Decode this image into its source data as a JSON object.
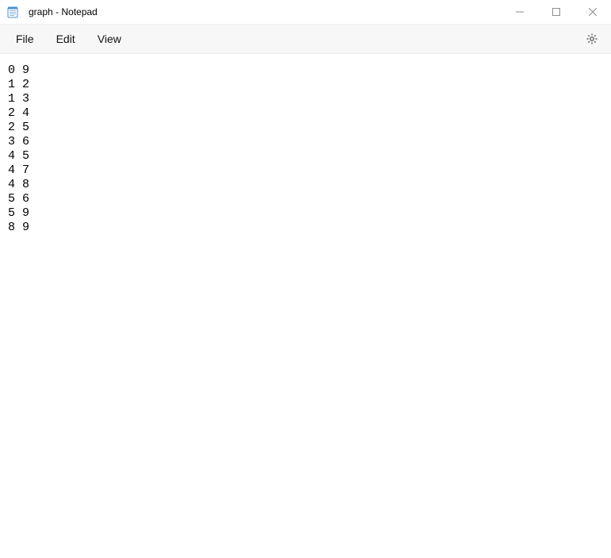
{
  "window": {
    "title": "graph - Notepad"
  },
  "menu": {
    "file": "File",
    "edit": "Edit",
    "view": "View"
  },
  "content": {
    "text": "0 9\n1 2\n1 3\n2 4\n2 5\n3 6\n4 5\n4 7\n4 8\n5 6\n5 9\n8 9"
  }
}
